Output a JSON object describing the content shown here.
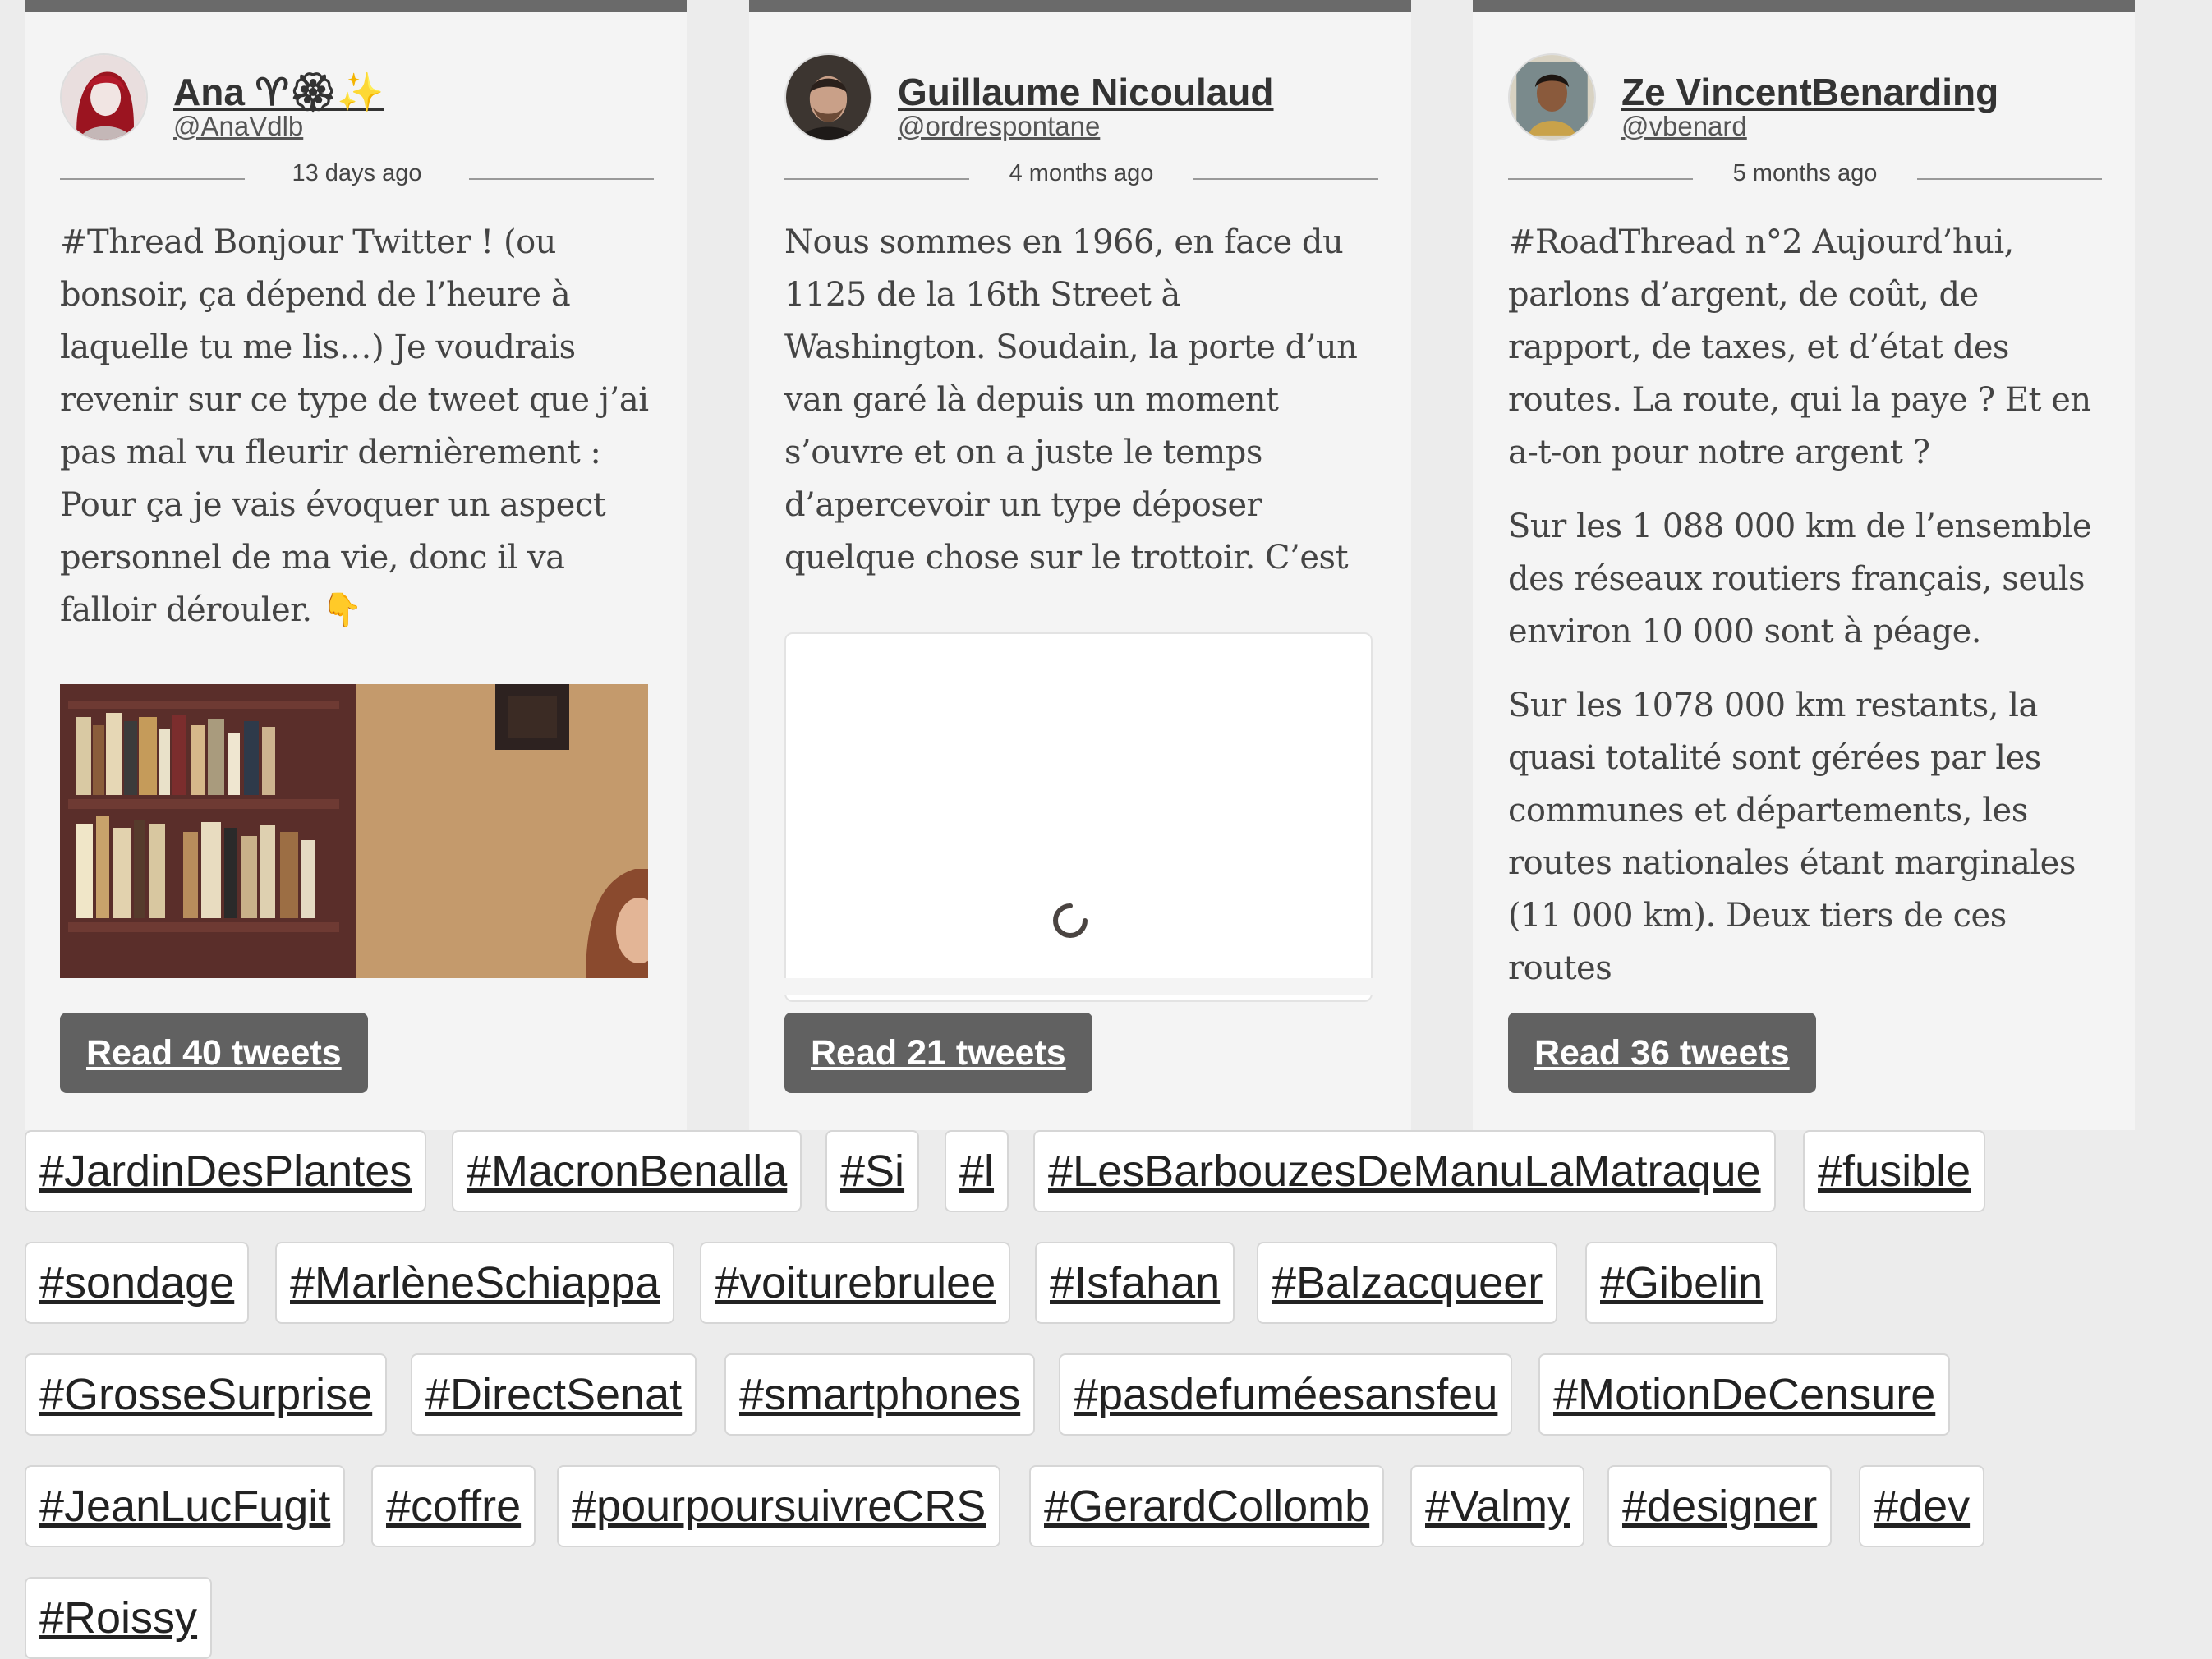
{
  "cards": [
    {
      "author_name": "Ana ♈︎🏵✨",
      "author_handle": "@AnaVdlb",
      "time_ago": "13 days ago",
      "paragraphs": [
        "#Thread Bonjour Twitter ! (ou bonsoir, ça dépend de l’heure à laquelle tu me lis…) Je voudrais revenir sur ce type de tweet que j’ai pas mal vu fleurir dernièrement : Pour ça je vais évoquer un aspect personnel de ma vie, donc il va falloir dérouler. 👇"
      ],
      "media": "photo",
      "read_label": "Read 40 tweets"
    },
    {
      "author_name": "Guillaume Nicoulaud",
      "author_handle": "@ordrespontane",
      "time_ago": "4 months ago",
      "paragraphs": [
        "Nous sommes en 1966, en face du 1125 de la 16th Street à Washington. Soudain, la porte d’un van garé là depuis un moment s’ouvre et on a juste le temps d’apercevoir un type déposer quelque chose sur le trottoir. C’est un chat blanc et gris. #Thread"
      ],
      "media": "loading-embed",
      "read_label": "Read 21 tweets"
    },
    {
      "author_name": "Ze VincentBenarding",
      "author_handle": "@vbenard",
      "time_ago": "5 months ago",
      "paragraphs": [
        "#RoadThread n°2 Aujourd’hui, parlons d’argent, de coût, de rapport, de taxes, et d’état des routes. La route, qui la paye ? Et en a-t-on pour notre argent ?",
        "Sur les 1 088 000 km de l’ensemble des réseaux routiers français, seuls environ 10 000 sont à péage.",
        "Sur les 1078 000 km restants, la quasi totalité sont gérées par les communes et départements, les routes nationales étant marginales (11 000 km). Deux tiers de ces routes"
      ],
      "media": "none",
      "read_label": "Read 36 tweets"
    }
  ],
  "hashtags": [
    "#JardinDesPlantes",
    "#MacronBenalla",
    "#Si",
    "#l",
    "#LesBarbouzesDeManuLaMatraque",
    "#fusible",
    "#sondage",
    "#MarlèneSchiappa",
    "#voiturebrulee",
    "#Isfahan",
    "#Balzacqueer",
    "#Gibelin",
    "#GrosseSurprise",
    "#DirectSenat",
    "#smartphones",
    "#pasdefuméesansfeu",
    "#MotionDeCensure",
    "#JeanLucFugit",
    "#coffre",
    "#pourpoursuivreCRS",
    "#GerardCollomb",
    "#Valmy",
    "#designer",
    "#dev",
    "#Roissy"
  ],
  "colors": {
    "page_bg": "#ececec",
    "card_bg": "#f4f4f4",
    "card_top_bar": "#6a6a6a",
    "button_bg": "#616161",
    "button_text": "#ffffff"
  },
  "icons": [
    "avatar",
    "loading-spinner-icon"
  ]
}
